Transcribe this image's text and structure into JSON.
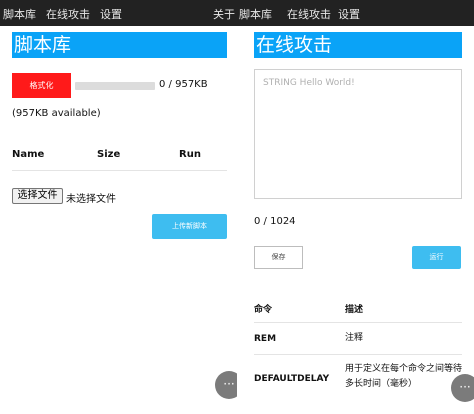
{
  "nav": {
    "script_lib": "脚本库",
    "online_attack": "在线攻击",
    "settings": "设置",
    "about": "关于"
  },
  "left_pane": {
    "title": "脚本库",
    "format_label": "格式化",
    "usage_text": "0 / 957KB",
    "usage_fraction": 0,
    "available_text": "(957KB available)",
    "columns": [
      "Name",
      "Size",
      "Run"
    ],
    "file_button": "选择文件",
    "file_status": "未选择文件",
    "upload_label": "上传新脚本",
    "more_label": "···"
  },
  "right_pane": {
    "title": "在线攻击",
    "editor_placeholder": "STRING Hello World!",
    "char_count": "0 / 1024",
    "save_label": "保存",
    "run_label": "运行",
    "columns": [
      "命令",
      "描述"
    ],
    "commands": [
      {
        "name": "REM",
        "desc": "注释"
      },
      {
        "name": "DEFAULTDELAY",
        "desc": "用于定义在每个命令之间等待多长时间（毫秒）"
      }
    ],
    "more_label": "···"
  },
  "colors": {
    "topbar": "#222222",
    "banner": "#0aa3f7",
    "format_button": "#ff1a1a",
    "accent_button": "#3ebdf0"
  }
}
